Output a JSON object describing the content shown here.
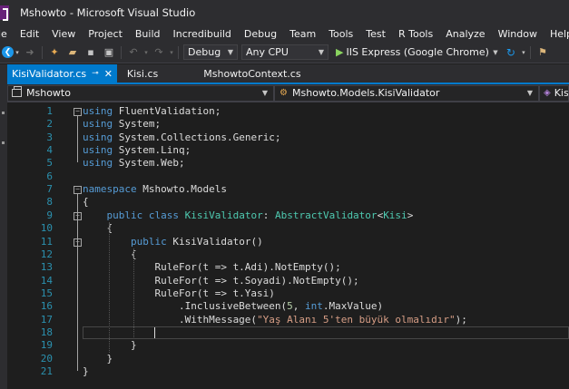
{
  "window": {
    "title": "Mshowto - Microsoft Visual Studio"
  },
  "menu": [
    "File",
    "Edit",
    "View",
    "Project",
    "Build",
    "Incredibuild",
    "Debug",
    "Team",
    "Tools",
    "Test",
    "R Tools",
    "Analyze",
    "Window",
    "Help"
  ],
  "menu_first_visible": "le",
  "toolbar": {
    "configuration": "Debug",
    "platform": "Any CPU",
    "run_target": "IIS Express (Google Chrome)"
  },
  "tabs": [
    {
      "label": "KisiValidator.cs",
      "active": true
    },
    {
      "label": "Kisi.cs",
      "active": false
    },
    {
      "label": "MshowtoContext.cs",
      "active": false
    }
  ],
  "nav": {
    "project": "Mshowto",
    "type": "Mshowto.Models.KisiValidator",
    "member": "Kisi"
  },
  "code_lines": [
    "using FluentValidation;",
    "using System;",
    "using System.Collections.Generic;",
    "using System.Linq;",
    "using System.Web;",
    "",
    "namespace Mshowto.Models",
    "{",
    "    public class KisiValidator: AbstractValidator<Kisi>",
    "    {",
    "        public KisiValidator()",
    "        {",
    "            RuleFor(t => t.Adi).NotEmpty();",
    "            RuleFor(t => t.Soyadi).NotEmpty();",
    "            RuleFor(t => t.Yasi)",
    "                .InclusiveBetween(5, int.MaxValue)",
    "                .WithMessage(\"Yaş Alanı 5'ten büyük olmalıdır\");",
    "",
    "        }",
    "    }",
    "}"
  ],
  "colors": {
    "accent": "#007acc",
    "keyword": "#569cd6",
    "type": "#4ec9b0",
    "string": "#d69d85",
    "number": "#b5cea8",
    "line_number": "#2b91af"
  }
}
